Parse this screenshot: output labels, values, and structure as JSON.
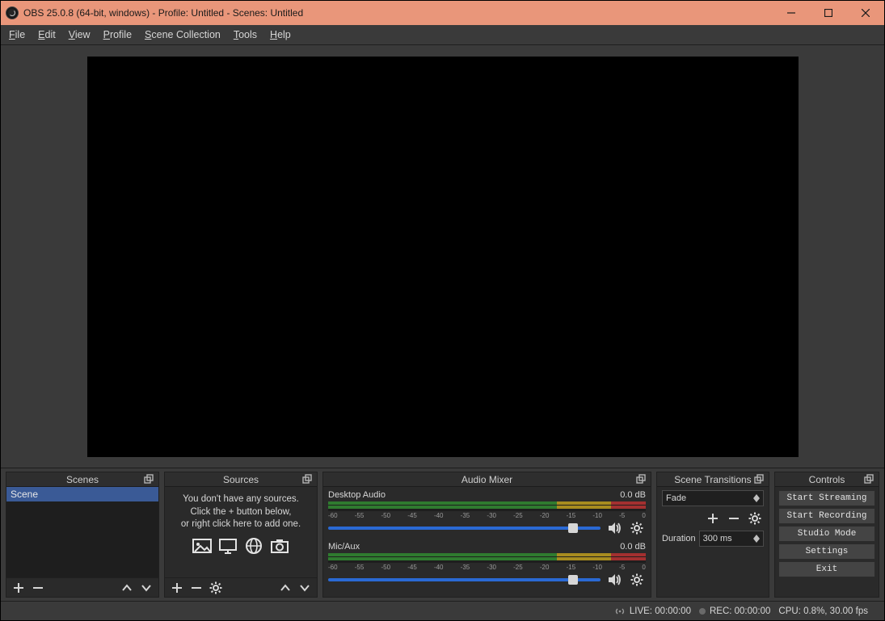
{
  "titlebar": {
    "title": "OBS 25.0.8 (64-bit, windows) - Profile: Untitled - Scenes: Untitled"
  },
  "menu": {
    "file": "File",
    "edit": "Edit",
    "view": "View",
    "profile": "Profile",
    "scene_collection": "Scene Collection",
    "tools": "Tools",
    "help": "Help"
  },
  "scenes": {
    "title": "Scenes",
    "items": [
      {
        "name": "Scene"
      }
    ]
  },
  "sources": {
    "title": "Sources",
    "hint1": "You don't have any sources.",
    "hint2": "Click the + button below,",
    "hint3": "or right click here to add one."
  },
  "mixer": {
    "title": "Audio Mixer",
    "channels": [
      {
        "name": "Desktop Audio",
        "db": "0.0 dB",
        "ticks": [
          "-60",
          "-55",
          "-50",
          "-45",
          "-40",
          "-35",
          "-30",
          "-25",
          "-20",
          "-15",
          "-10",
          "-5",
          "0"
        ]
      },
      {
        "name": "Mic/Aux",
        "db": "0.0 dB",
        "ticks": [
          "-60",
          "-55",
          "-50",
          "-45",
          "-40",
          "-35",
          "-30",
          "-25",
          "-20",
          "-15",
          "-10",
          "-5",
          "0"
        ]
      }
    ]
  },
  "transitions": {
    "title": "Scene Transitions",
    "selected": "Fade",
    "duration_label": "Duration",
    "duration_value": "300 ms"
  },
  "controls": {
    "title": "Controls",
    "buttons": {
      "start_streaming": "Start Streaming",
      "start_recording": "Start Recording",
      "studio_mode": "Studio Mode",
      "settings": "Settings",
      "exit": "Exit"
    }
  },
  "status": {
    "live": "LIVE: 00:00:00",
    "rec": "REC: 00:00:00",
    "cpu": "CPU: 0.8%, 30.00 fps"
  }
}
